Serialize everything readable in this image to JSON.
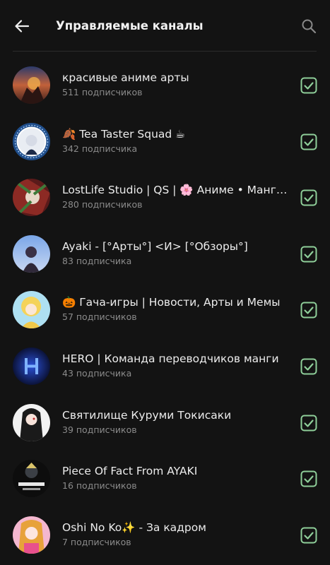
{
  "header": {
    "title": "Управляемые каналы",
    "back_icon": "arrow-left-icon",
    "search_icon": "search-icon"
  },
  "colors": {
    "background": "#131313",
    "accent_green": "#8fcf9a",
    "text_primary": "#ececec",
    "text_secondary": "#8b8b8b"
  },
  "channels": [
    {
      "name": "красивые аниме арты",
      "subscribers": "511 подписчиков",
      "checked": true
    },
    {
      "name": "🍂 Tea Taster Squad ☕",
      "subscribers": "342 подписчика",
      "checked": true
    },
    {
      "name": "LostLife Studio | QS | 🌸 Аниме • Манга • Арты",
      "subscribers": "280 подписчиков",
      "checked": true
    },
    {
      "name": "Ayaki - [°Арты°] <И> [°Обзоры°]",
      "subscribers": "83 подписчика",
      "checked": true
    },
    {
      "name": "🎃 Гача-игры | Новости, Арты и Мемы",
      "subscribers": "57 подписчиков",
      "checked": true
    },
    {
      "name": "HERO | Команда переводчиков манги",
      "subscribers": "43 подписчика",
      "checked": true
    },
    {
      "name": "Святилище Куруми Токисаки",
      "subscribers": "39 подписчиков",
      "checked": true
    },
    {
      "name": "Piece Of Fact From AYAKI",
      "subscribers": "16 подписчиков",
      "checked": true
    },
    {
      "name": "Oshi No Ko✨ - За кадром",
      "subscribers": "7 подписчиков",
      "checked": true
    }
  ]
}
